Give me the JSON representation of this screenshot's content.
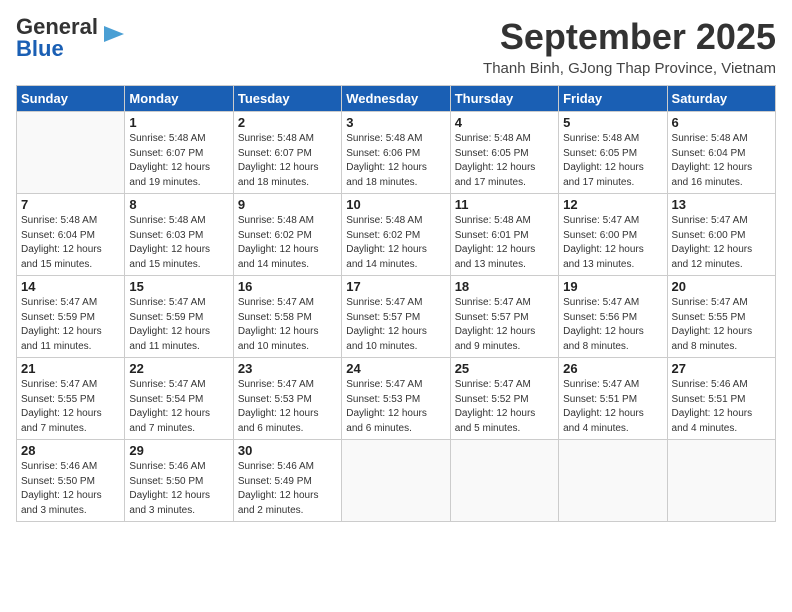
{
  "header": {
    "logo_general": "General",
    "logo_blue": "Blue",
    "month": "September 2025",
    "location": "Thanh Binh, GJong Thap Province, Vietnam"
  },
  "weekdays": [
    "Sunday",
    "Monday",
    "Tuesday",
    "Wednesday",
    "Thursday",
    "Friday",
    "Saturday"
  ],
  "weeks": [
    [
      null,
      {
        "day": 1,
        "sunrise": "5:48 AM",
        "sunset": "6:07 PM",
        "daylight": "12 hours and 19 minutes."
      },
      {
        "day": 2,
        "sunrise": "5:48 AM",
        "sunset": "6:07 PM",
        "daylight": "12 hours and 18 minutes."
      },
      {
        "day": 3,
        "sunrise": "5:48 AM",
        "sunset": "6:06 PM",
        "daylight": "12 hours and 18 minutes."
      },
      {
        "day": 4,
        "sunrise": "5:48 AM",
        "sunset": "6:05 PM",
        "daylight": "12 hours and 17 minutes."
      },
      {
        "day": 5,
        "sunrise": "5:48 AM",
        "sunset": "6:05 PM",
        "daylight": "12 hours and 17 minutes."
      },
      {
        "day": 6,
        "sunrise": "5:48 AM",
        "sunset": "6:04 PM",
        "daylight": "12 hours and 16 minutes."
      }
    ],
    [
      {
        "day": 7,
        "sunrise": "5:48 AM",
        "sunset": "6:04 PM",
        "daylight": "12 hours and 15 minutes."
      },
      {
        "day": 8,
        "sunrise": "5:48 AM",
        "sunset": "6:03 PM",
        "daylight": "12 hours and 15 minutes."
      },
      {
        "day": 9,
        "sunrise": "5:48 AM",
        "sunset": "6:02 PM",
        "daylight": "12 hours and 14 minutes."
      },
      {
        "day": 10,
        "sunrise": "5:48 AM",
        "sunset": "6:02 PM",
        "daylight": "12 hours and 14 minutes."
      },
      {
        "day": 11,
        "sunrise": "5:48 AM",
        "sunset": "6:01 PM",
        "daylight": "12 hours and 13 minutes."
      },
      {
        "day": 12,
        "sunrise": "5:47 AM",
        "sunset": "6:00 PM",
        "daylight": "12 hours and 13 minutes."
      },
      {
        "day": 13,
        "sunrise": "5:47 AM",
        "sunset": "6:00 PM",
        "daylight": "12 hours and 12 minutes."
      }
    ],
    [
      {
        "day": 14,
        "sunrise": "5:47 AM",
        "sunset": "5:59 PM",
        "daylight": "12 hours and 11 minutes."
      },
      {
        "day": 15,
        "sunrise": "5:47 AM",
        "sunset": "5:59 PM",
        "daylight": "12 hours and 11 minutes."
      },
      {
        "day": 16,
        "sunrise": "5:47 AM",
        "sunset": "5:58 PM",
        "daylight": "12 hours and 10 minutes."
      },
      {
        "day": 17,
        "sunrise": "5:47 AM",
        "sunset": "5:57 PM",
        "daylight": "12 hours and 10 minutes."
      },
      {
        "day": 18,
        "sunrise": "5:47 AM",
        "sunset": "5:57 PM",
        "daylight": "12 hours and 9 minutes."
      },
      {
        "day": 19,
        "sunrise": "5:47 AM",
        "sunset": "5:56 PM",
        "daylight": "12 hours and 8 minutes."
      },
      {
        "day": 20,
        "sunrise": "5:47 AM",
        "sunset": "5:55 PM",
        "daylight": "12 hours and 8 minutes."
      }
    ],
    [
      {
        "day": 21,
        "sunrise": "5:47 AM",
        "sunset": "5:55 PM",
        "daylight": "12 hours and 7 minutes."
      },
      {
        "day": 22,
        "sunrise": "5:47 AM",
        "sunset": "5:54 PM",
        "daylight": "12 hours and 7 minutes."
      },
      {
        "day": 23,
        "sunrise": "5:47 AM",
        "sunset": "5:53 PM",
        "daylight": "12 hours and 6 minutes."
      },
      {
        "day": 24,
        "sunrise": "5:47 AM",
        "sunset": "5:53 PM",
        "daylight": "12 hours and 6 minutes."
      },
      {
        "day": 25,
        "sunrise": "5:47 AM",
        "sunset": "5:52 PM",
        "daylight": "12 hours and 5 minutes."
      },
      {
        "day": 26,
        "sunrise": "5:47 AM",
        "sunset": "5:51 PM",
        "daylight": "12 hours and 4 minutes."
      },
      {
        "day": 27,
        "sunrise": "5:46 AM",
        "sunset": "5:51 PM",
        "daylight": "12 hours and 4 minutes."
      }
    ],
    [
      {
        "day": 28,
        "sunrise": "5:46 AM",
        "sunset": "5:50 PM",
        "daylight": "12 hours and 3 minutes."
      },
      {
        "day": 29,
        "sunrise": "5:46 AM",
        "sunset": "5:50 PM",
        "daylight": "12 hours and 3 minutes."
      },
      {
        "day": 30,
        "sunrise": "5:46 AM",
        "sunset": "5:49 PM",
        "daylight": "12 hours and 2 minutes."
      },
      null,
      null,
      null,
      null
    ]
  ]
}
